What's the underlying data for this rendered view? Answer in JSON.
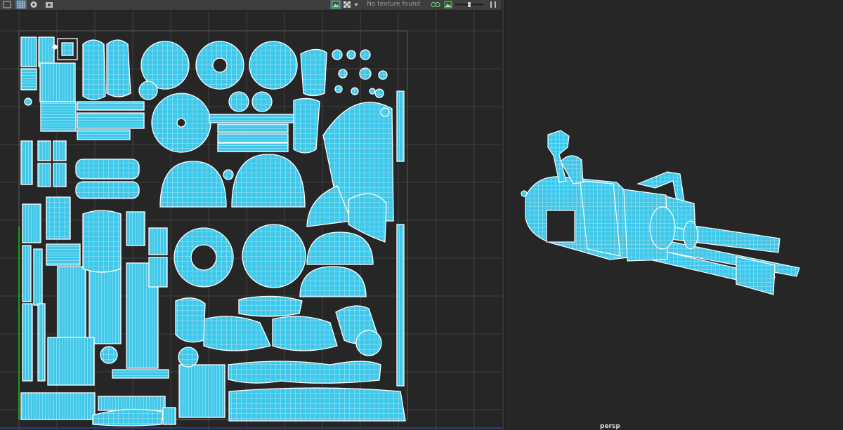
{
  "uv_editor": {
    "toolbar": {
      "texture_status": "No texture found",
      "icons": [
        "frame-icon",
        "grid-toggle-icon",
        "shading-icon",
        "snapshot-icon",
        "image-display-icon",
        "checker-icon",
        "dropdown-arrow-icon",
        "uv-shell-icon",
        "uv-toggle-icon",
        "exposure-slider",
        "panel-menu-icon"
      ]
    },
    "colors": {
      "background": "#262626",
      "grid_line": "#404040",
      "wireframe_white": "#ffffff",
      "uv_fill": "#3fc8ea",
      "axis_u": "#c81e1e",
      "axis_v": "#1e9b1e",
      "border_blue": "#2c3a8a"
    }
  },
  "viewport_3d": {
    "camera_label": "persp",
    "model_color": "#3fc8ea",
    "model_wire": "#ffffff"
  }
}
